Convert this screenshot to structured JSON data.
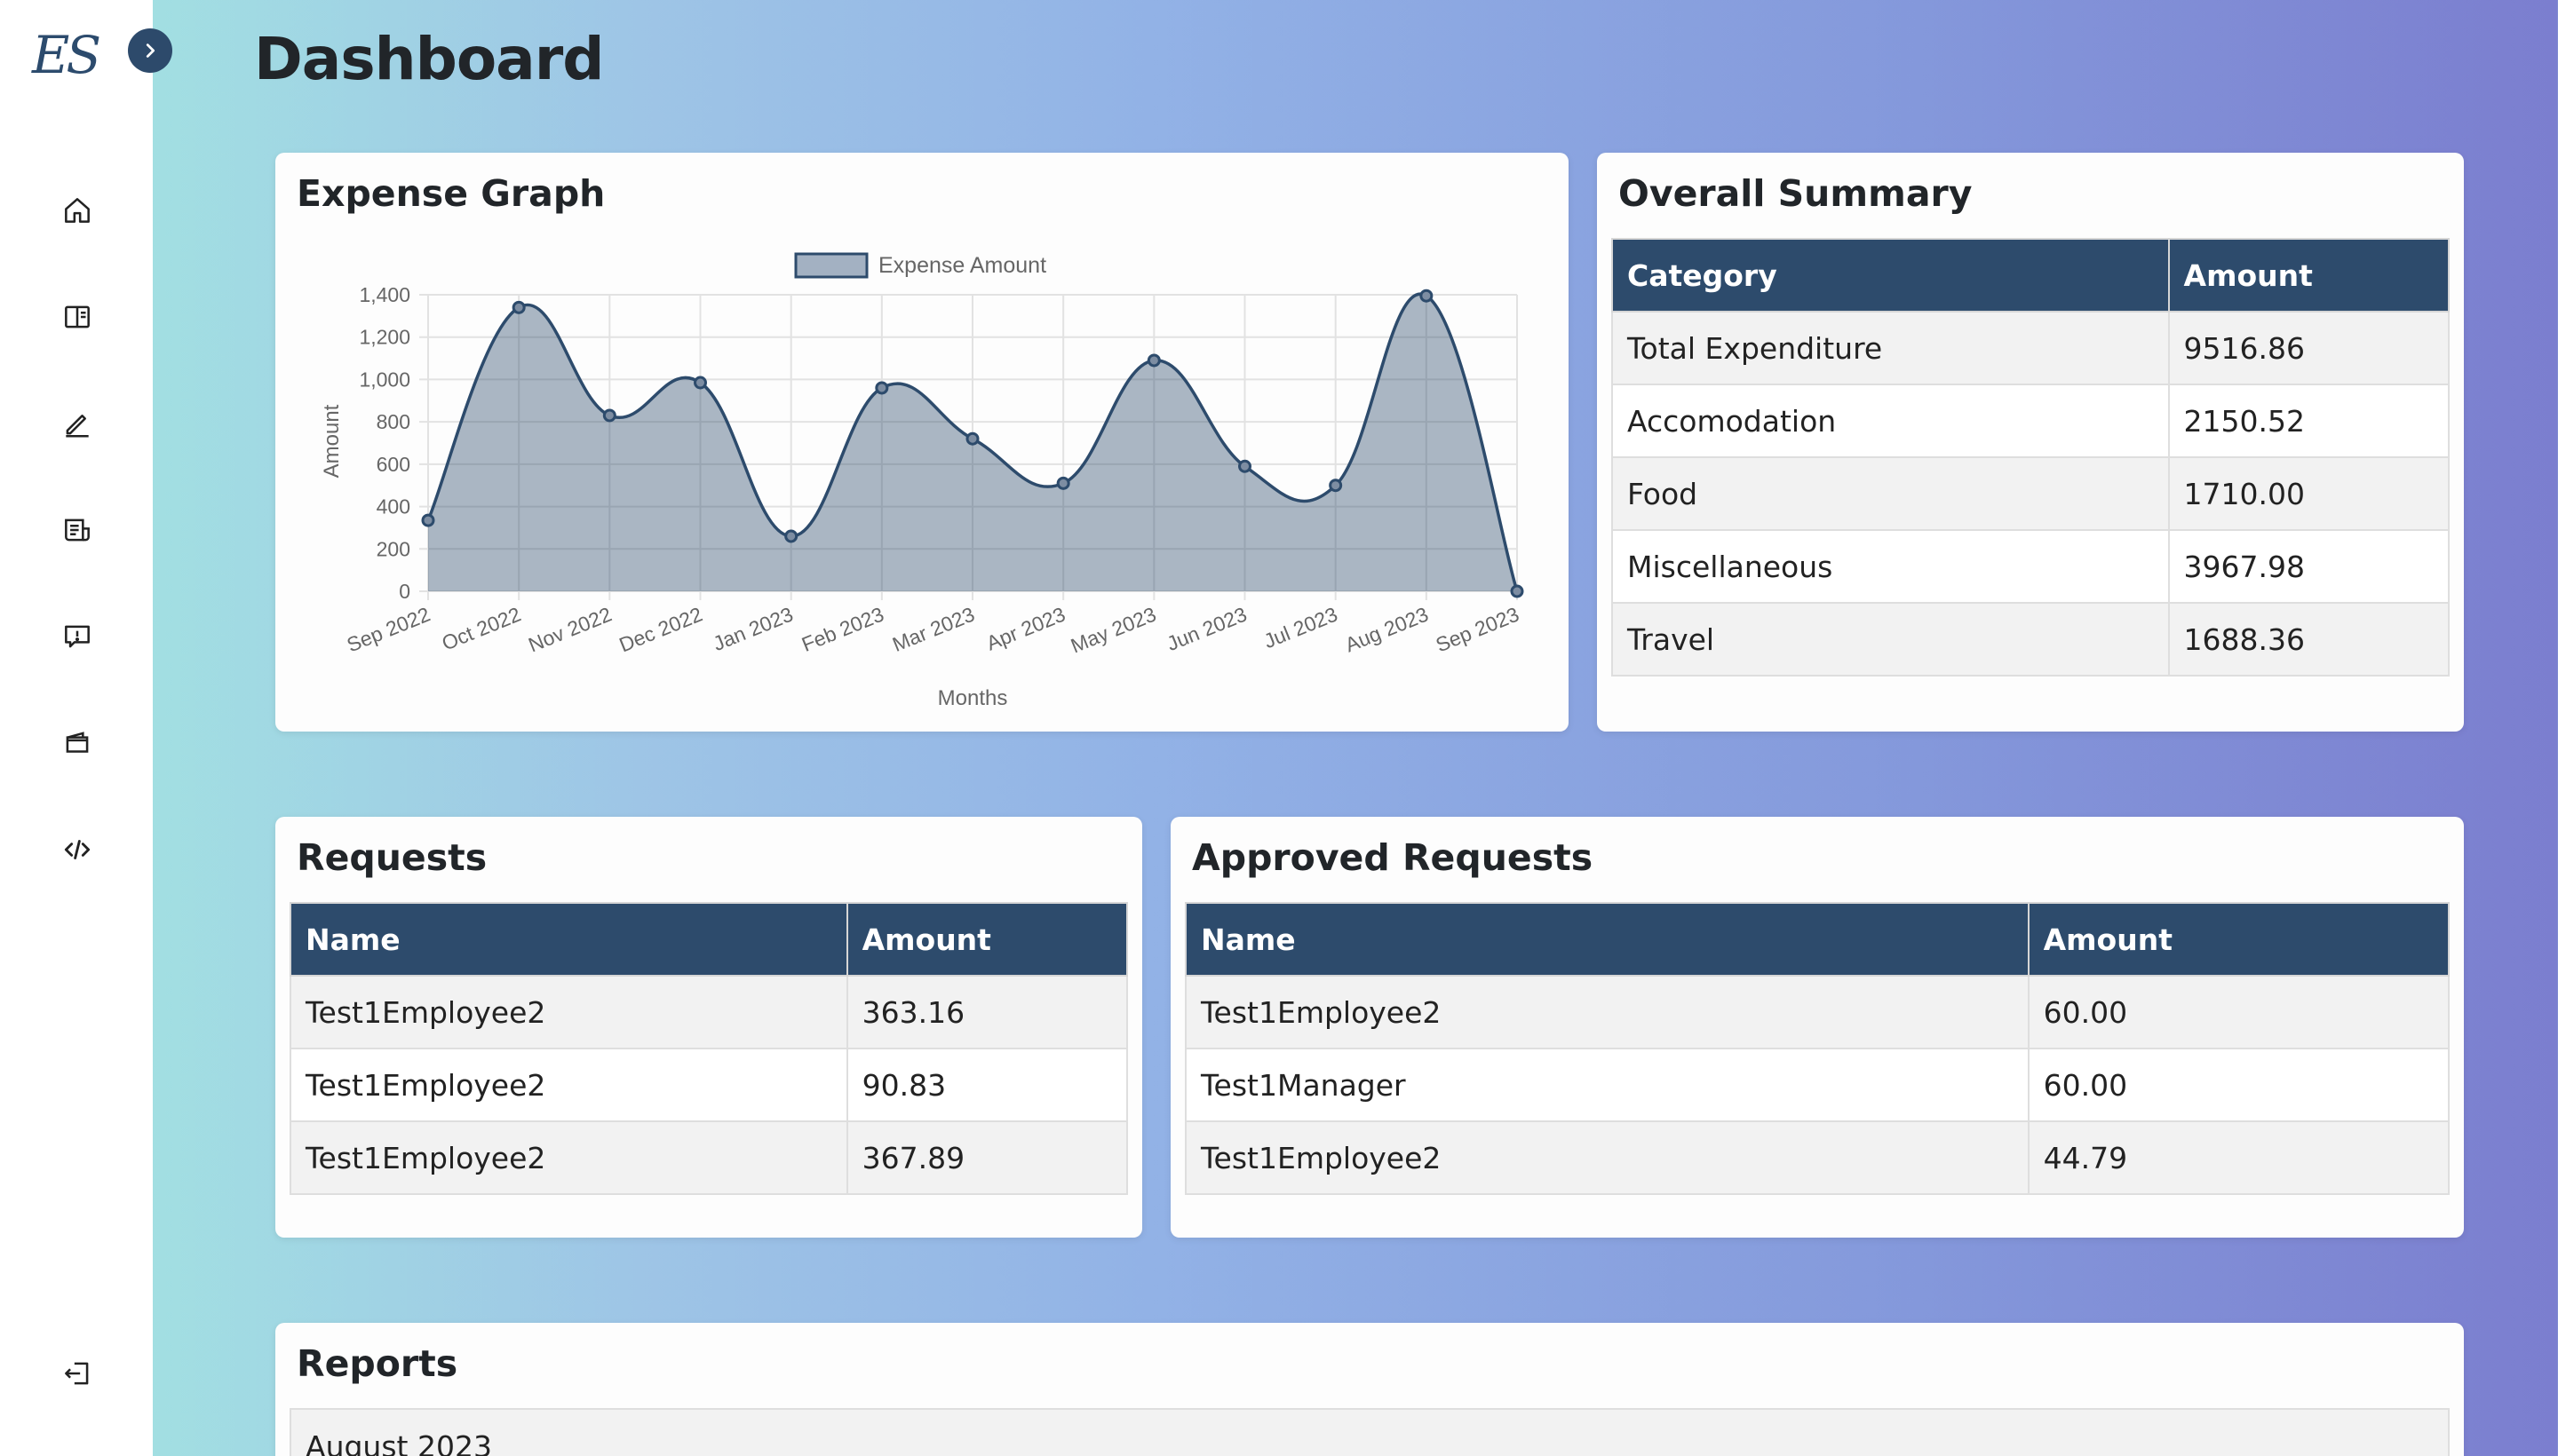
{
  "app": {
    "logo_text": "ES",
    "page_title": "Dashboard"
  },
  "sidebar": {
    "toggle_icon": "chevron-right-icon",
    "items": [
      {
        "icon": "home-icon"
      },
      {
        "icon": "book-icon"
      },
      {
        "icon": "pencil-icon"
      },
      {
        "icon": "receipt-icon"
      },
      {
        "icon": "report-alert-icon"
      },
      {
        "icon": "wallet-icon"
      },
      {
        "icon": "code-icon"
      }
    ],
    "logout_icon": "logout-icon"
  },
  "colors": {
    "accent": "#2d4b6c",
    "chart_fill": "#a3b1c2",
    "sidebar_bg": "#ffffff"
  },
  "expense_graph": {
    "title": "Expense Graph"
  },
  "chart_data": {
    "type": "area",
    "legend": [
      "Expense Amount"
    ],
    "legend_position": "top",
    "xlabel": "Months",
    "ylabel": "Amount",
    "ylim": [
      0,
      1400
    ],
    "yticks": [
      0,
      200,
      400,
      600,
      800,
      1000,
      1200,
      1400
    ],
    "grid": true,
    "categories": [
      "Sep 2022",
      "Oct 2022",
      "Nov 2022",
      "Dec 2022",
      "Jan 2023",
      "Feb 2023",
      "Mar 2023",
      "Apr 2023",
      "May 2023",
      "Jun 2023",
      "Jul 2023",
      "Aug 2023",
      "Sep 2023"
    ],
    "series": [
      {
        "name": "Expense Amount",
        "values": [
          335,
          1340,
          830,
          985,
          260,
          960,
          720,
          510,
          1090,
          590,
          500,
          1395,
          0
        ]
      }
    ]
  },
  "overall_summary": {
    "title": "Overall Summary",
    "headers": [
      "Category",
      "Amount"
    ],
    "rows": [
      [
        "Total Expenditure",
        "9516.86"
      ],
      [
        "Accomodation",
        "2150.52"
      ],
      [
        "Food",
        "1710.00"
      ],
      [
        "Miscellaneous",
        "3967.98"
      ],
      [
        "Travel",
        "1688.36"
      ]
    ]
  },
  "requests": {
    "title": "Requests",
    "headers": [
      "Name",
      "Amount"
    ],
    "rows": [
      [
        "Test1Employee2",
        "363.16"
      ],
      [
        "Test1Employee2",
        "90.83"
      ],
      [
        "Test1Employee2",
        "367.89"
      ]
    ]
  },
  "approved_requests": {
    "title": "Approved Requests",
    "headers": [
      "Name",
      "Amount"
    ],
    "rows": [
      [
        "Test1Employee2",
        "60.00"
      ],
      [
        "Test1Manager",
        "60.00"
      ],
      [
        "Test1Employee2",
        "44.79"
      ]
    ]
  },
  "reports": {
    "title": "Reports",
    "rows": [
      "August 2023"
    ]
  }
}
